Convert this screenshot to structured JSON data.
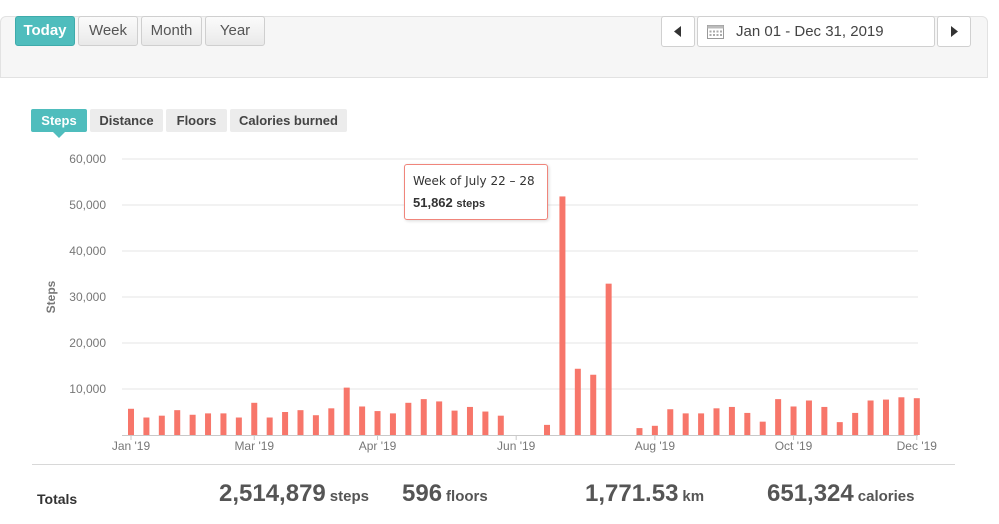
{
  "toolbar": {
    "ranges": [
      {
        "label": "Today",
        "active": true
      },
      {
        "label": "Week",
        "active": false
      },
      {
        "label": "Month",
        "active": false
      },
      {
        "label": "Year",
        "active": false
      }
    ],
    "prev_icon": "caret-left-icon",
    "next_icon": "caret-right-icon",
    "calendar_icon": "calendar-icon",
    "date_range": "Jan 01 - Dec 31, 2019"
  },
  "metric_tabs": [
    {
      "label": "Steps",
      "active": true
    },
    {
      "label": "Distance",
      "active": false
    },
    {
      "label": "Floors",
      "active": false
    },
    {
      "label": "Calories burned",
      "active": false
    }
  ],
  "colors": {
    "accent": "#4fbdbd",
    "bar": "#f7766a",
    "grid": "#e6e6e6"
  },
  "chart_data": {
    "type": "bar",
    "ylabel": "Steps",
    "ylim": [
      0,
      60000
    ],
    "yticks": [
      "60,000",
      "50,000",
      "40,000",
      "30,000",
      "20,000",
      "10,000"
    ],
    "ytick_values": [
      60000,
      50000,
      40000,
      30000,
      20000,
      10000
    ],
    "xtick_labels": [
      "Jan '19",
      "Mar '19",
      "Apr '19",
      "Jun '19",
      "Aug '19",
      "Oct '19",
      "Dec '19"
    ],
    "xtick_weeks": [
      1,
      9,
      17,
      26,
      35,
      44,
      52
    ],
    "grid": true,
    "series": [
      {
        "values": [
          5700,
          3800,
          4200,
          5400,
          4400,
          4700,
          4700,
          3800,
          7000,
          3800,
          5000,
          5400,
          4300,
          5800,
          10300,
          6200,
          5200,
          4700,
          7000,
          7800,
          7300,
          5300,
          6100,
          5100,
          4200,
          0,
          0,
          2200,
          51862,
          14400,
          13100,
          32900,
          0,
          1500,
          2000,
          5600,
          4700,
          4700,
          5800,
          6100,
          4800,
          2900,
          7800,
          6200,
          7500,
          6100,
          2800,
          4800,
          7500,
          7700,
          8200,
          8000
        ]
      }
    ]
  },
  "tooltip": {
    "title": "Week of July 22 – 28",
    "value": "51,862",
    "unit": "steps"
  },
  "totals": {
    "label": "Totals",
    "steps": {
      "value": "2,514,879",
      "unit": "steps"
    },
    "floors": {
      "value": "596",
      "unit": "floors"
    },
    "distance": {
      "value": "1,771.53",
      "unit": "km"
    },
    "calories": {
      "value": "651,324",
      "unit": "calories"
    }
  }
}
